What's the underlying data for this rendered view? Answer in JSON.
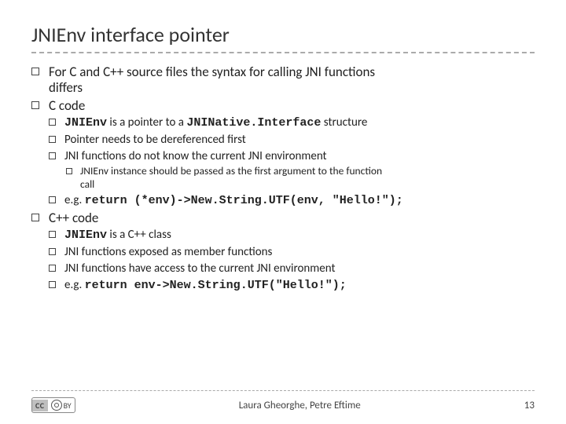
{
  "title": "JNIEnv interface pointer",
  "b1_1_a": "For C and C++ source files the syntax for calling JNI functions",
  "b1_1_b": "differs",
  "b1_2": "C code",
  "b2_1_a": "JNIEnv",
  "b2_1_b": " is a pointer to a ",
  "b2_1_c": "JNINative.Interface",
  "b2_1_d": " structure",
  "b2_2": "Pointer needs to be dereferenced first",
  "b2_3": "JNI functions do not know the current JNI environment",
  "b3_1_a": "JNIEnv instance should be passed as the first argument to the function",
  "b3_1_b": "call",
  "b2_4_a": "e.g. ",
  "b2_4_b": "return (*env)->New.String.UTF(env, \"Hello!\");",
  "b1_3": "C++ code",
  "c2_1_a": "JNIEnv",
  "c2_1_b": " is a C++ class",
  "c2_2": "JNI functions exposed as member functions",
  "c2_3": "JNI functions have access to the current JNI environment",
  "c2_4_a": "e.g. ",
  "c2_4_b": "return env->New.String.UTF(\"Hello!\");",
  "cc_label": "CC",
  "cc_by": "BY",
  "footer_center": "Laura Gheorghe, Petre Eftime",
  "page_number": "13"
}
